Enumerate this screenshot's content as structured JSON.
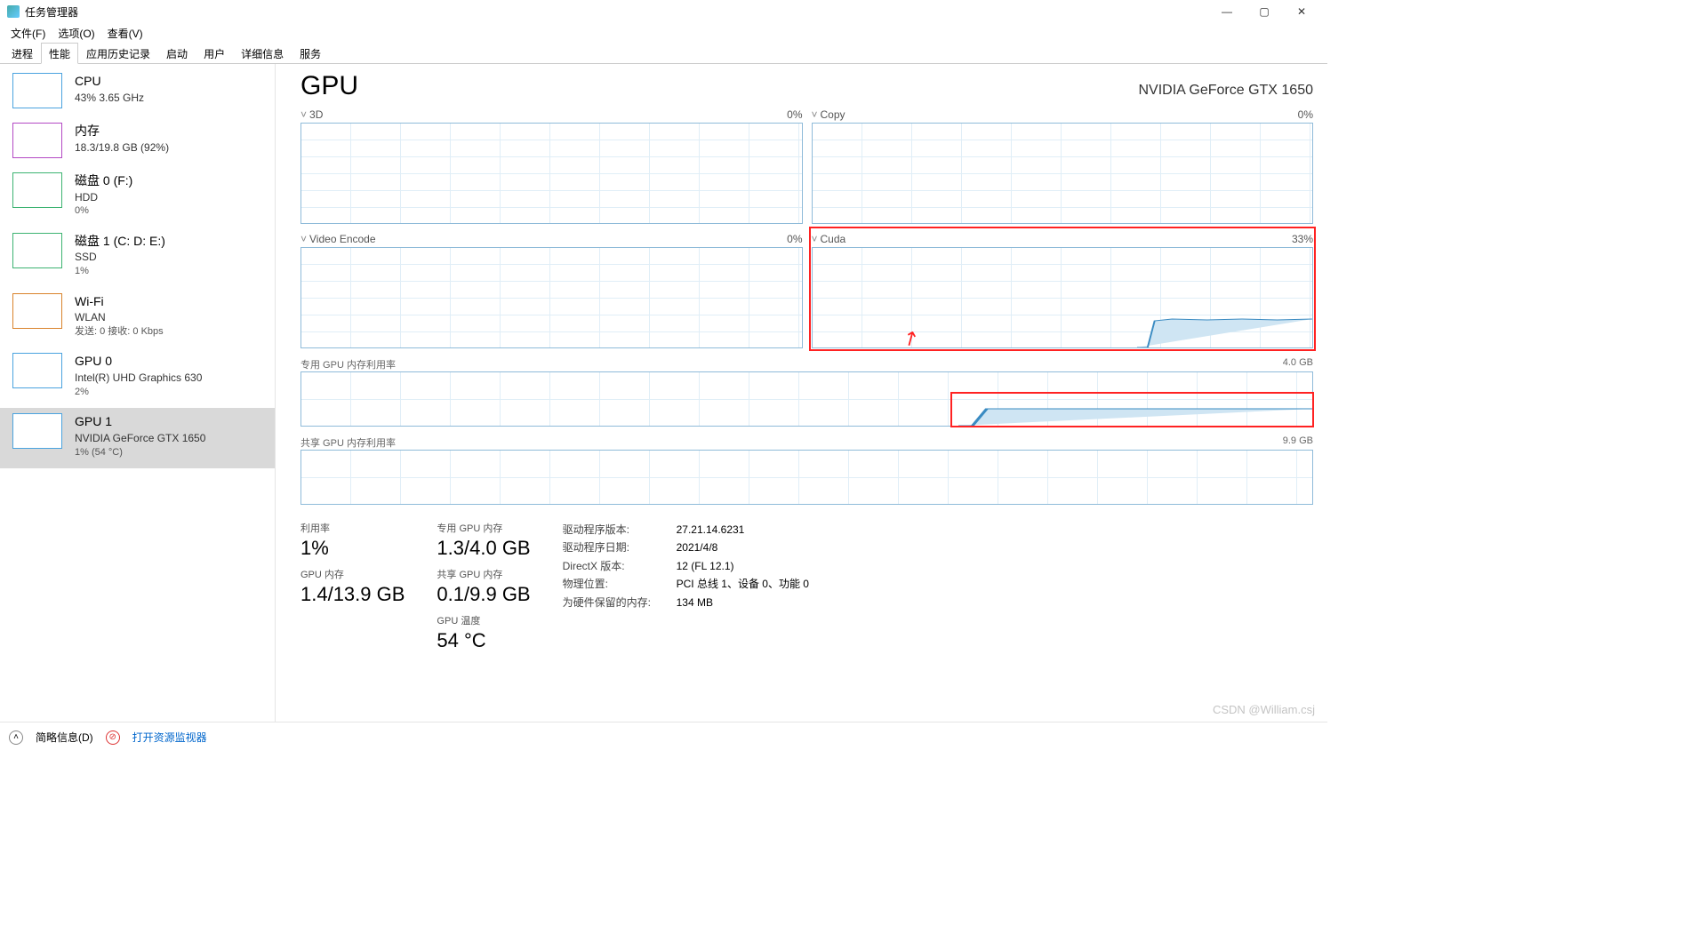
{
  "window": {
    "title": "任务管理器",
    "min": "—",
    "max": "▢",
    "close": "✕"
  },
  "menu": {
    "file": "文件(F)",
    "options": "选项(O)",
    "view": "查看(V)"
  },
  "tabs": [
    "进程",
    "性能",
    "应用历史记录",
    "启动",
    "用户",
    "详细信息",
    "服务"
  ],
  "active_tab": 1,
  "sidebar": [
    {
      "color": "#4aa3df",
      "title": "CPU",
      "sub1": "43%  3.65 GHz"
    },
    {
      "color": "#b349c4",
      "title": "内存",
      "sub1": "18.3/19.8 GB (92%)"
    },
    {
      "color": "#3cb371",
      "title": "磁盘 0 (F:)",
      "sub1": "HDD",
      "sub2": "0%"
    },
    {
      "color": "#3cb371",
      "title": "磁盘 1 (C: D: E:)",
      "sub1": "SSD",
      "sub2": "1%"
    },
    {
      "color": "#d9822b",
      "title": "Wi-Fi",
      "sub1": "WLAN",
      "sub2": "发送: 0 接收: 0 Kbps"
    },
    {
      "color": "#4aa3df",
      "title": "GPU 0",
      "sub1": "Intel(R) UHD Graphics 630",
      "sub2": "2%"
    },
    {
      "color": "#4aa3df",
      "title": "GPU 1",
      "sub1": "NVIDIA GeForce GTX 1650",
      "sub2": "1% (54 °C)",
      "selected": true
    }
  ],
  "header": {
    "title": "GPU",
    "device": "NVIDIA GeForce GTX 1650"
  },
  "small_charts": [
    {
      "name": "3D",
      "pct": "0%"
    },
    {
      "name": "Copy",
      "pct": "0%"
    },
    {
      "name": "Video Encode",
      "pct": "0%"
    },
    {
      "name": "Cuda",
      "pct": "33%",
      "highlight": true
    }
  ],
  "wide_charts": [
    {
      "label": "专用 GPU 内存利用率",
      "right": "4.0 GB",
      "highlight": true
    },
    {
      "label": "共享 GPU 内存利用率",
      "right": "9.9 GB"
    }
  ],
  "stats": {
    "util_lbl": "利用率",
    "util": "1%",
    "gmem_lbl": "GPU 内存",
    "gmem": "1.4/13.9 GB",
    "dmem_lbl": "专用 GPU 内存",
    "dmem": "1.3/4.0 GB",
    "smem_lbl": "共享 GPU 内存",
    "smem": "0.1/9.9 GB",
    "temp_lbl": "GPU 温度",
    "temp": "54 °C"
  },
  "kv": [
    {
      "k": "驱动程序版本:",
      "v": "27.21.14.6231"
    },
    {
      "k": "驱动程序日期:",
      "v": "2021/4/8"
    },
    {
      "k": "DirectX 版本:",
      "v": "12 (FL 12.1)"
    },
    {
      "k": "物理位置:",
      "v": "PCI 总线 1、设备 0、功能 0"
    },
    {
      "k": "为硬件保留的内存:",
      "v": "134 MB"
    }
  ],
  "footer": {
    "brief": "简略信息(D)",
    "resmon": "打开资源监视器"
  },
  "watermark": "CSDN @William.csj",
  "chart_data": {
    "type": "line",
    "charts": [
      {
        "name": "3D",
        "ylim": [
          0,
          100
        ],
        "series": [
          {
            "name": "3D",
            "values_pct": "flat 0"
          }
        ]
      },
      {
        "name": "Copy",
        "ylim": [
          0,
          100
        ],
        "series": [
          {
            "name": "Copy",
            "values_pct": "flat 0 with tiny spike near end"
          }
        ]
      },
      {
        "name": "Video Encode",
        "ylim": [
          0,
          100
        ],
        "series": [
          {
            "name": "Video Encode",
            "values_pct": "flat 0"
          }
        ]
      },
      {
        "name": "Cuda",
        "ylim": [
          0,
          100
        ],
        "series": [
          {
            "name": "Cuda",
            "approx_values": [
              0,
              0,
              0,
              0,
              0,
              0,
              0,
              0,
              0,
              0,
              0,
              0,
              0,
              0,
              30,
              33,
              31,
              33,
              32,
              33
            ]
          }
        ]
      },
      {
        "name": "专用 GPU 内存利用率",
        "ylim_gb": [
          0,
          4.0
        ],
        "series": [
          {
            "name": "dedicated",
            "approx_values_gb": [
              0.05,
              0.05,
              0.05,
              0.05,
              0.05,
              0.05,
              0.05,
              0.05,
              0.05,
              0.05,
              0.05,
              0.05,
              0.05,
              0.1,
              1.2,
              1.3,
              1.3,
              1.3,
              1.3,
              1.3
            ]
          }
        ]
      },
      {
        "name": "共享 GPU 内存利用率",
        "ylim_gb": [
          0,
          9.9
        ],
        "series": [
          {
            "name": "shared",
            "approx_values_gb": "flat ~0.1"
          }
        ]
      }
    ]
  }
}
